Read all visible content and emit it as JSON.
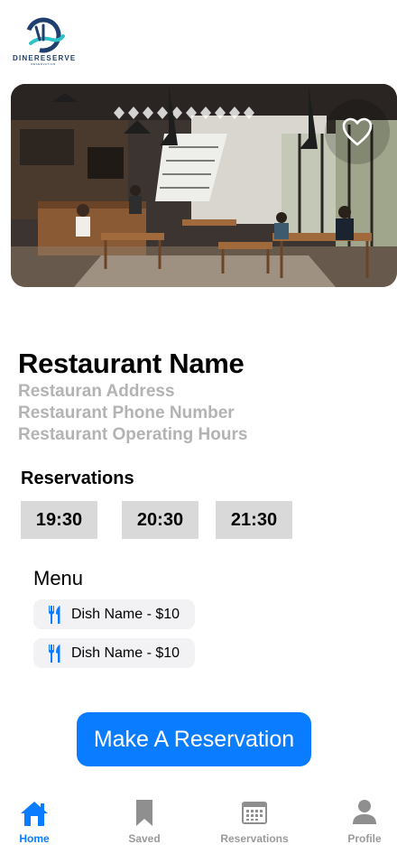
{
  "brand": {
    "name": "DINERESERVE",
    "tagline": "RESERVATION"
  },
  "restaurant": {
    "name": "Restaurant Name",
    "address": "Restauran Address",
    "phone": "Restaurant Phone Number",
    "hours": "Restaurant Operating Hours"
  },
  "reservations": {
    "title": "Reservations",
    "slots": [
      "19:30",
      "20:30",
      "21:30"
    ]
  },
  "menu": {
    "title": "Menu",
    "items": [
      {
        "label": "Dish Name - $10",
        "icon": "fork-knife-icon"
      },
      {
        "label": "Dish Name - $10",
        "icon": "fork-knife-icon"
      }
    ]
  },
  "cta": {
    "label": "Make A Reservation"
  },
  "hero": {
    "icon": "heart-icon",
    "favorited": false
  },
  "tabbar": {
    "items": [
      {
        "label": "Home",
        "icon": "home-icon",
        "active": true
      },
      {
        "label": "Saved",
        "icon": "bookmark-icon",
        "active": false
      },
      {
        "label": "Reservations",
        "icon": "calendar-icon",
        "active": false
      },
      {
        "label": "Profile",
        "icon": "person-icon",
        "active": false
      }
    ]
  },
  "colors": {
    "accent": "#0a7cff",
    "slot_bg": "#d9d9d9",
    "muted_text": "#b3b3b3",
    "chip_bg": "#f2f2f4"
  }
}
